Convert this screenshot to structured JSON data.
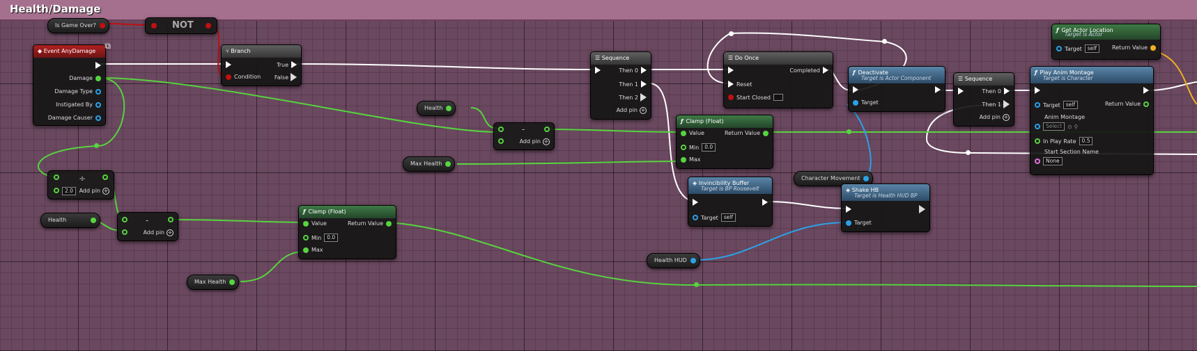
{
  "comment": {
    "title": "Health/Damage"
  },
  "nodes": {
    "is_game_over": {
      "label": "Is Game Over?"
    },
    "not": {
      "label": "NOT"
    },
    "event_any_damage": {
      "title": "Event AnyDamage",
      "pins": [
        "Damage",
        "Damage Type",
        "Instigated By",
        "Damage Causer"
      ]
    },
    "branch": {
      "title": "Branch",
      "condition": "Condition",
      "true_label": "True",
      "false_label": "False"
    },
    "sequence1": {
      "title": "Sequence",
      "outs": [
        "Then 0",
        "Then 1",
        "Then 2"
      ],
      "add_pin": "Add pin"
    },
    "do_once": {
      "title": "Do Once",
      "completed": "Completed",
      "reset": "Reset",
      "start_closed": "Start Closed"
    },
    "deactivate": {
      "title": "Deactivate",
      "subtitle": "Target is Actor Component",
      "target": "Target"
    },
    "sequence2": {
      "title": "Sequence",
      "outs": [
        "Then 0",
        "Then 1"
      ],
      "add_pin": "Add pin"
    },
    "get_actor_location": {
      "title": "Get Actor Location",
      "subtitle": "Target is Actor",
      "target": "Target",
      "target_value": "self",
      "return_value": "Return Value"
    },
    "play_anim_montage": {
      "title": "Play Anim Montage",
      "subtitle": "Target is Character",
      "target": "Target",
      "target_value": "self",
      "return_value": "Return Value",
      "anim_montage": "Anim Montage",
      "anim_montage_value": "Select",
      "in_play_rate": "In Play Rate",
      "in_play_rate_value": "0.5",
      "start_section_name": "Start Section Name",
      "start_section_value": "None"
    },
    "health1": {
      "label": "Health"
    },
    "subtract1": {
      "symbol": "-",
      "add_pin": "Add pin"
    },
    "clamp1": {
      "title": "Clamp (Float)",
      "value": "Value",
      "return_value": "Return Value",
      "min": "Min",
      "min_value": "0.0",
      "max": "Max"
    },
    "max_health1": {
      "label": "Max Health"
    },
    "divide": {
      "symbol": "÷",
      "value": "2.0",
      "add_pin": "Add pin"
    },
    "health2": {
      "label": "Health"
    },
    "subtract2": {
      "symbol": "-",
      "add_pin": "Add pin"
    },
    "clamp2": {
      "title": "Clamp (Float)",
      "value": "Value",
      "return_value": "Return Value",
      "min": "Min",
      "min_value": "0.0",
      "max": "Max"
    },
    "max_health2": {
      "label": "Max Health"
    },
    "invincibility": {
      "title": "Invincibility Buffer",
      "subtitle": "Target is BP Roosevelt",
      "target": "Target",
      "target_value": "self"
    },
    "character_movement": {
      "label": "Character Movement"
    },
    "shake_hb": {
      "title": "Shake HB",
      "subtitle": "Target is Health HUD BP",
      "target": "Target"
    },
    "health_hud": {
      "label": "Health HUD"
    }
  },
  "colors": {
    "comment_header": "#a5708e",
    "graph_bg": "#5e3f55",
    "float_pin": "#57d43f",
    "bool_pin": "#c01010",
    "object_pin": "#2aa2e8",
    "vector_pin": "#f0b020",
    "exec_wire": "#ffffff"
  }
}
